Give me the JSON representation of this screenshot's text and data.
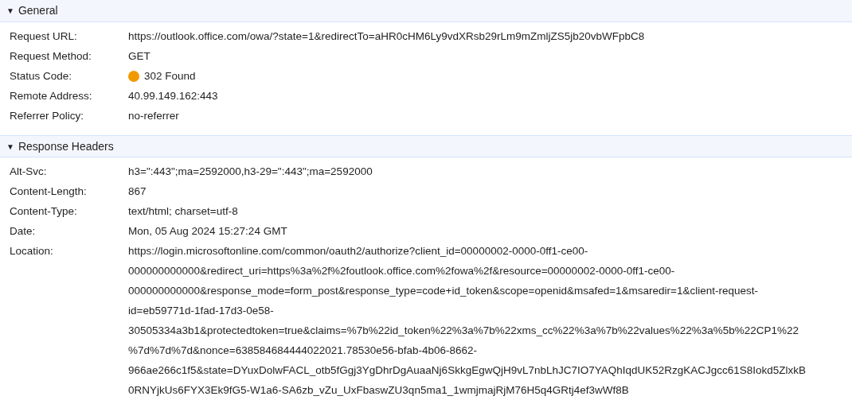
{
  "sections": [
    {
      "toggle": "▼",
      "title": "General",
      "expanded": true,
      "rows": [
        {
          "name": "Request URL:",
          "lines": [
            "https://outlook.office.com/owa/?state=1&redirectTo=aHR0cHM6Ly9vdXRsb29rLm9mZmljZS5jb20vbWFpbC8"
          ]
        },
        {
          "name": "Request Method:",
          "lines": [
            "GET"
          ]
        },
        {
          "name": "Status Code:",
          "color": "#f29900",
          "lines": [
            "302 Found"
          ]
        },
        {
          "name": "Remote Address:",
          "lines": [
            "40.99.149.162:443"
          ]
        },
        {
          "name": "Referrer Policy:",
          "lines": [
            "no-referrer"
          ]
        }
      ]
    },
    {
      "toggle": "▼",
      "title": "Response Headers",
      "expanded": true,
      "rows": [
        {
          "name": "Alt-Svc:",
          "lines": [
            "h3=\":443\";ma=2592000,h3-29=\":443\";ma=2592000"
          ]
        },
        {
          "name": "Content-Length:",
          "lines": [
            "867"
          ]
        },
        {
          "name": "Content-Type:",
          "lines": [
            "text/html; charset=utf-8"
          ]
        },
        {
          "name": "Date:",
          "lines": [
            "Mon, 05 Aug 2024 15:27:24 GMT"
          ]
        },
        {
          "name": "Location:",
          "lines": [
            "https://login.microsoftonline.com/common/oauth2/authorize?client_id=00000002-0000-0ff1-ce00-",
            "000000000000&redirect_uri=https%3a%2f%2foutlook.office.com%2fowa%2f&resource=00000002-0000-0ff1-ce00-",
            "000000000000&response_mode=form_post&response_type=code+id_token&scope=openid&msafed=1&msaredir=1&client-request-",
            "id=eb59771d-1fad-17d3-0e58-",
            "30505334a3b1&protectedtoken=true&claims=%7b%22id_token%22%3a%7b%22xms_cc%22%3a%7b%22values%22%3a%5b%22CP1%22",
            "%7d%7d%7d&nonce=638584684444022021.78530e56-bfab-4b06-8662-",
            "966ae266c1f5&state=DYuxDolwFACL_otb5fGgj3YgDhrDgAuaaNj6SkkgEgwQjH9vL7nbLhJC7IO7YAQhIqdUK52RzgKACJgcc61S8Iokd5ZlxkB",
            "0RNYjkUs6FYX3Ek9fG5-W1a6-SA6zb_vZu_UxFbaswZU3qn5ma1_1wmjmajRjM76H5q4GRtj4ef3wWf8B"
          ]
        }
      ]
    }
  ]
}
